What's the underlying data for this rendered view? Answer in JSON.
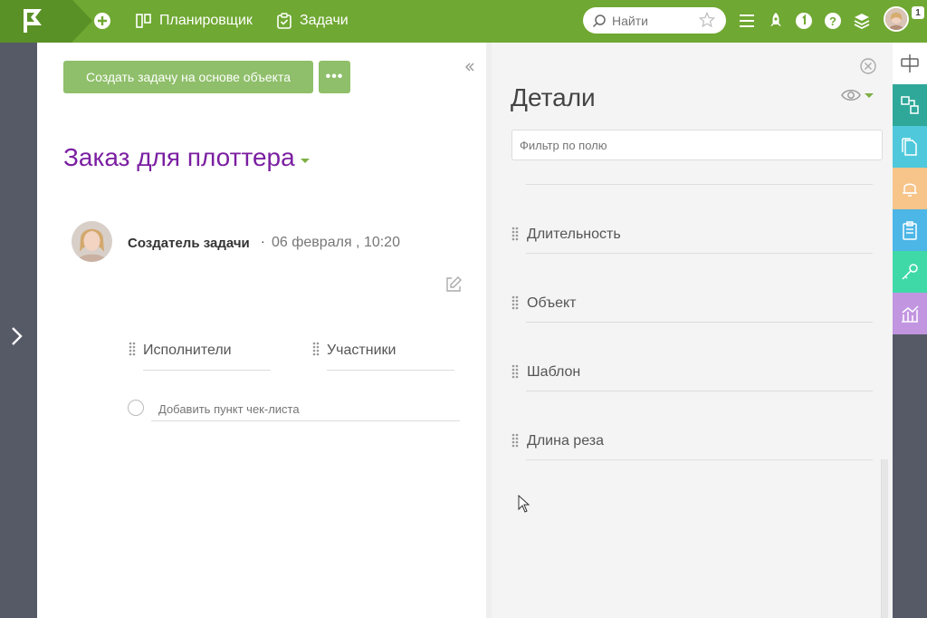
{
  "topbar": {
    "planner_label": "Планировщик",
    "tasks_label": "Задачи",
    "search_placeholder": "Найти",
    "notification_count": "1"
  },
  "task": {
    "create_button": "Создать задачу на основе объекта",
    "more_button": "•••",
    "title": "Заказ для плоттера",
    "author": "Создатель задачи",
    "separator": "·",
    "date": "06 февраля , 10:20",
    "fields": [
      {
        "label": "Исполнители"
      },
      {
        "label": "Участники"
      }
    ],
    "checklist_placeholder": "Добавить пункт чек-листа"
  },
  "details": {
    "title": "Детали",
    "filter_placeholder": "Фильтр по полю",
    "fields": [
      {
        "label": "Длительность"
      },
      {
        "label": "Объект"
      },
      {
        "label": "Шаблон"
      },
      {
        "label": "Длина реза"
      }
    ]
  },
  "colors": {
    "topbar": "#6fa832",
    "accent_green": "#8fbf6a",
    "title_purple": "#7b1fa2",
    "rail_teal": "#2fa89a",
    "rail_cyan": "#4fc8dc",
    "rail_orange": "#f7c48a",
    "rail_blue": "#4cb6e6",
    "rail_green": "#3fd9a8",
    "rail_purple": "#c295e0"
  },
  "icons": {
    "right_rail": [
      "links-icon",
      "document-icon",
      "bell-icon",
      "clipboard-icon",
      "key-icon",
      "chart-icon"
    ]
  }
}
